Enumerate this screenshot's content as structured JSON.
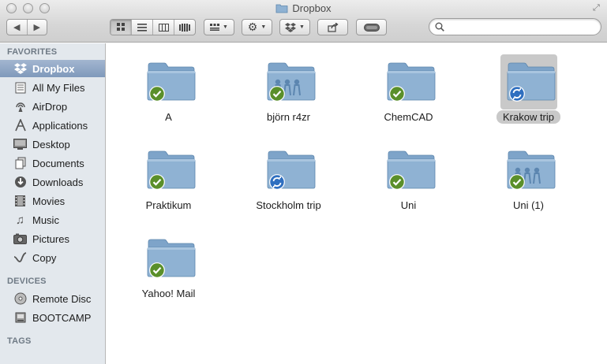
{
  "window": {
    "title": "Dropbox"
  },
  "toolbar": {
    "back_icon": "back-arrow-icon",
    "forward_icon": "forward-arrow-icon",
    "view_modes": [
      "icon-view-icon",
      "list-view-icon",
      "column-view-icon",
      "coverflow-view-icon"
    ],
    "arrange_icon": "arrange-icon",
    "action_icon": "gear-icon",
    "dropbox_menu_icon": "dropbox-icon",
    "share_icon": "share-icon",
    "label_icon": "label-toggle-icon"
  },
  "search": {
    "value": "",
    "placeholder": ""
  },
  "sidebar": {
    "favorites_header": "FAVORITES",
    "favorites": [
      {
        "label": "Dropbox",
        "icon": "dropbox-icon"
      },
      {
        "label": "All My Files",
        "icon": "all-files-icon"
      },
      {
        "label": "AirDrop",
        "icon": "airdrop-icon"
      },
      {
        "label": "Applications",
        "icon": "applications-icon"
      },
      {
        "label": "Desktop",
        "icon": "desktop-icon"
      },
      {
        "label": "Documents",
        "icon": "documents-icon"
      },
      {
        "label": "Downloads",
        "icon": "downloads-icon"
      },
      {
        "label": "Movies",
        "icon": "movies-icon"
      },
      {
        "label": "Music",
        "icon": "music-icon"
      },
      {
        "label": "Pictures",
        "icon": "pictures-icon"
      },
      {
        "label": "Copy",
        "icon": "copy-icon"
      }
    ],
    "devices_header": "DEVICES",
    "devices": [
      {
        "label": "Remote Disc",
        "icon": "disc-icon"
      },
      {
        "label": "BOOTCAMP",
        "icon": "drive-icon"
      }
    ],
    "tags_header": "TAGS"
  },
  "folders": [
    {
      "name": "A",
      "shared": false,
      "status": "synced"
    },
    {
      "name": "björn r4zr",
      "shared": true,
      "status": "synced"
    },
    {
      "name": "ChemCAD",
      "shared": false,
      "status": "synced"
    },
    {
      "name": "Krakow trip",
      "shared": false,
      "status": "syncing",
      "selected": true
    },
    {
      "name": "Praktikum",
      "shared": false,
      "status": "synced"
    },
    {
      "name": "Stockholm trip",
      "shared": false,
      "status": "syncing"
    },
    {
      "name": "Uni",
      "shared": false,
      "status": "synced"
    },
    {
      "name": "Uni (1)",
      "shared": true,
      "status": "synced"
    },
    {
      "name": "Yahoo! Mail",
      "shared": false,
      "status": "synced"
    }
  ],
  "colors": {
    "folder": "#8fb2d3",
    "synced_badge": "#5a8f2a",
    "syncing_badge": "#2f6fc0",
    "selection": "#c9c9c9"
  }
}
